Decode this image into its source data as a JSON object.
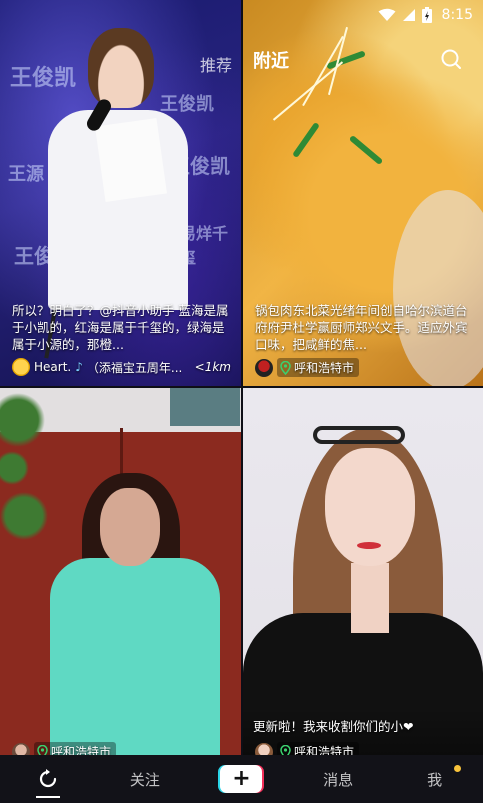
{
  "status_bar": {
    "time": "8:15"
  },
  "header": {
    "nearby_title": "附近",
    "recommend_tab": "推荐"
  },
  "feed": [
    {
      "caption": "所以？明白了？@抖音小助手 蓝海是属于小凯的，红海是属于千玺的，绿海是属于小源的，那橙...",
      "author": "Heart.",
      "music": "（添福宝五周年...",
      "distance": "<1km"
    },
    {
      "caption": "锅包肉东北菜光绪年间创自哈尔滨道台府府尹杜学赢厨师郑兴文手。适应外宾口味，把咸鲜的焦...",
      "location": "呼和浩特市"
    },
    {
      "caption": "",
      "location": "呼和浩特市"
    },
    {
      "caption": "更新啦！我来收割你们的小❤",
      "location": "呼和浩特市"
    }
  ],
  "bottom_nav": {
    "follow": "关注",
    "plus": "+",
    "messages": "消息",
    "me": "我"
  },
  "colors": {
    "accent_cyan": "#2ad5e8",
    "accent_red": "#f2305a",
    "badge": "#f8c33b",
    "nav_bg": "#121218"
  },
  "icons": {
    "top_search": "search-icon",
    "home": "refresh-home-icon",
    "location": "location-pin-icon"
  }
}
